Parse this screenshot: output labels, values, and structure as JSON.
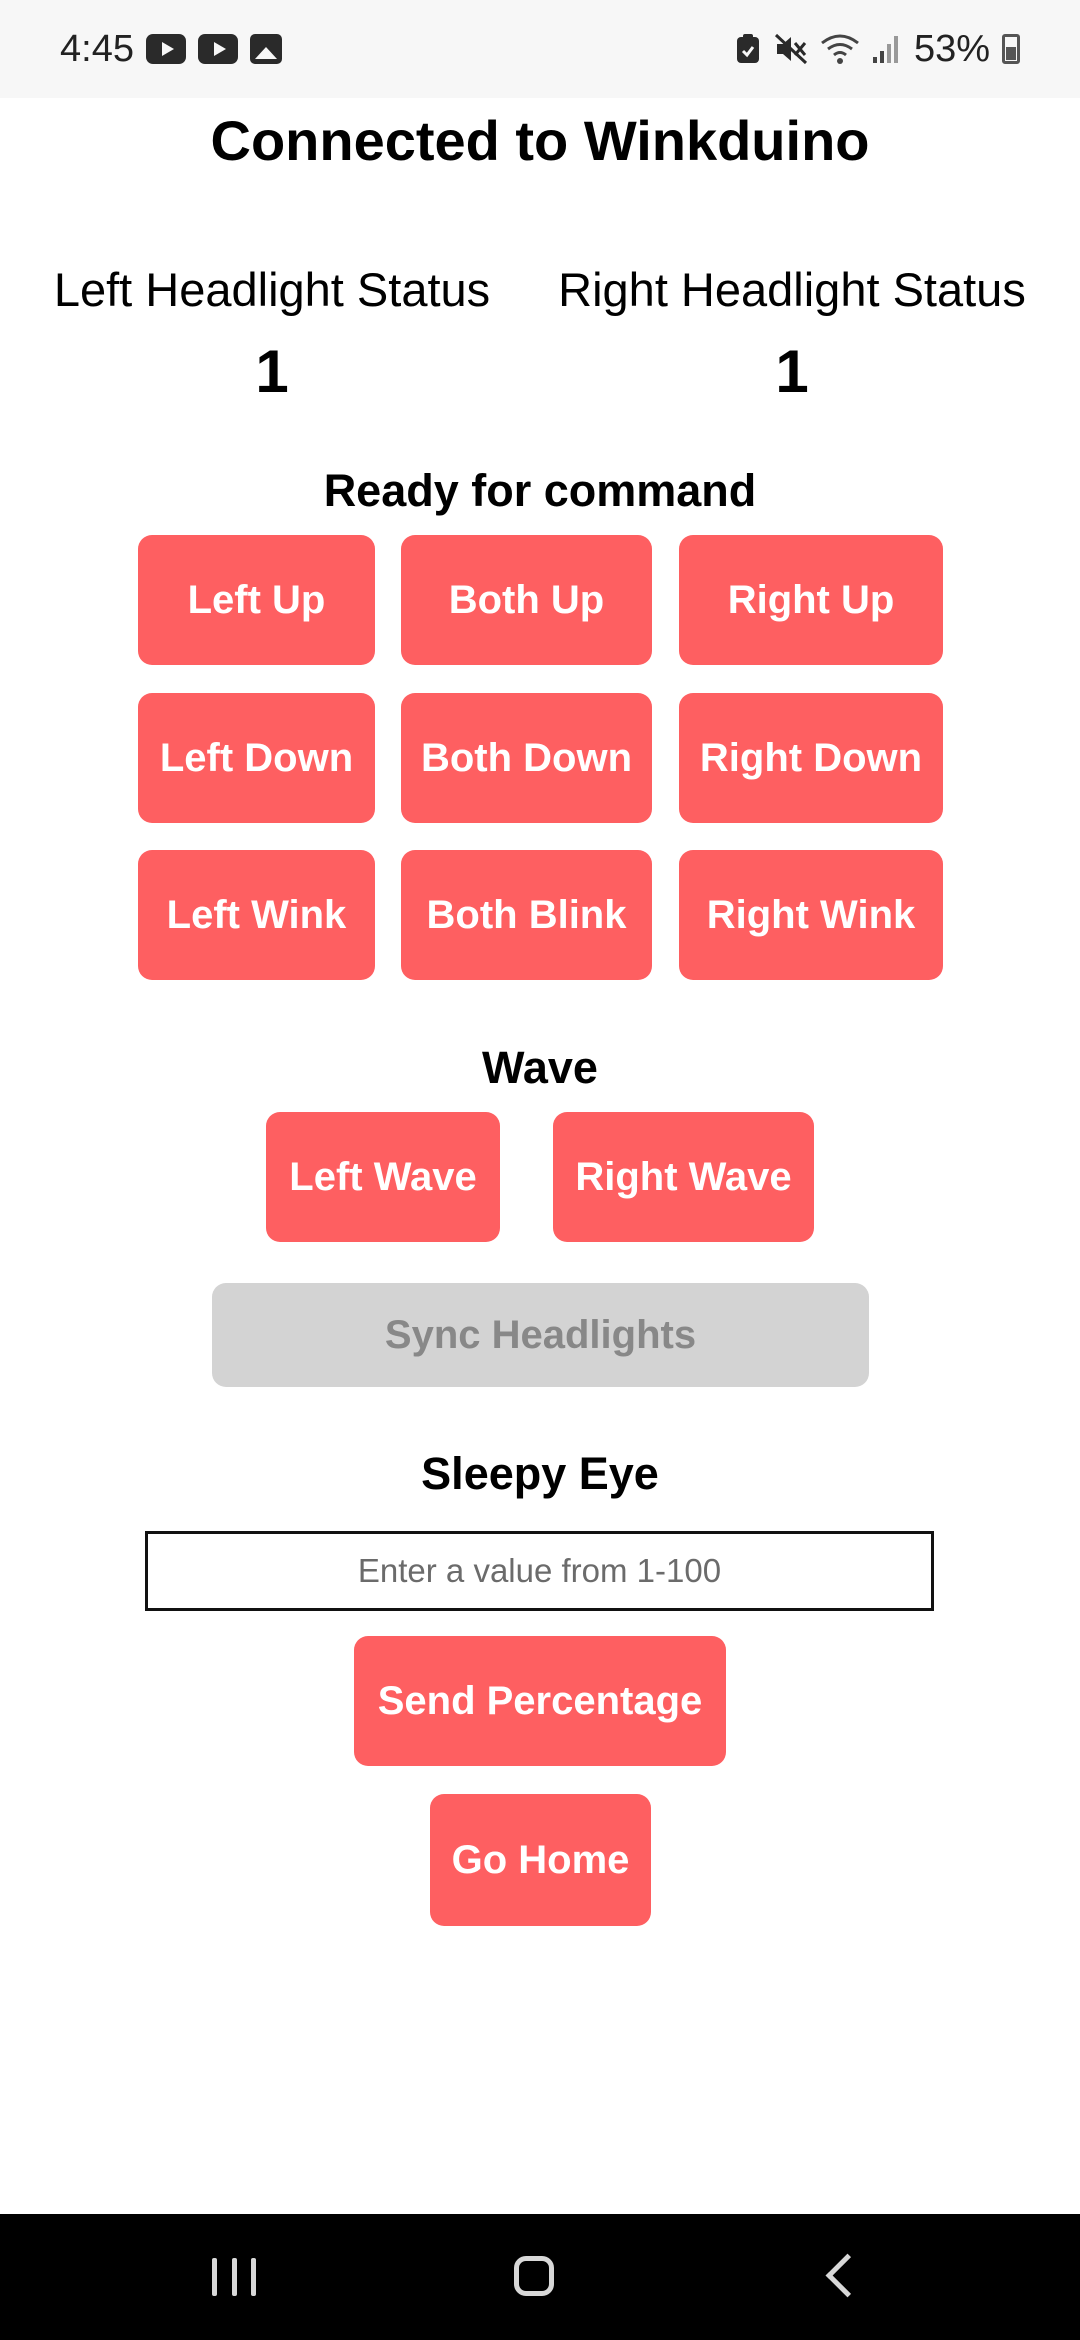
{
  "status_bar": {
    "time": "4:45",
    "battery": "53%",
    "left_icons": [
      "youtube-icon",
      "youtube-icon",
      "gallery-icon"
    ],
    "right_icons": [
      "clipboard-icon",
      "mute-icon",
      "wifi-icon",
      "signal-icon",
      "battery-icon"
    ]
  },
  "header": {
    "title": "Connected to Winkduino"
  },
  "headlights": {
    "left": {
      "label": "Left Headlight Status",
      "value": "1"
    },
    "right": {
      "label": "Right Headlight Status",
      "value": "1"
    }
  },
  "command": {
    "title": "Ready for command",
    "buttons": [
      {
        "label": "Left Up"
      },
      {
        "label": "Both Up"
      },
      {
        "label": "Right Up"
      },
      {
        "label": "Left Down"
      },
      {
        "label": "Both Down"
      },
      {
        "label": "Right Down"
      },
      {
        "label": "Left Wink"
      },
      {
        "label": "Both Blink"
      },
      {
        "label": "Right Wink"
      }
    ]
  },
  "wave": {
    "title": "Wave",
    "left_label": "Left Wave",
    "right_label": "Right Wave"
  },
  "sync": {
    "label": "Sync Headlights"
  },
  "sleepy": {
    "title": "Sleepy Eye",
    "placeholder": "Enter a value from 1-100",
    "send_label": "Send Percentage"
  },
  "home": {
    "label": "Go Home"
  },
  "colors": {
    "accent": "#fe5f61",
    "disabled": "#d3d3d3"
  }
}
